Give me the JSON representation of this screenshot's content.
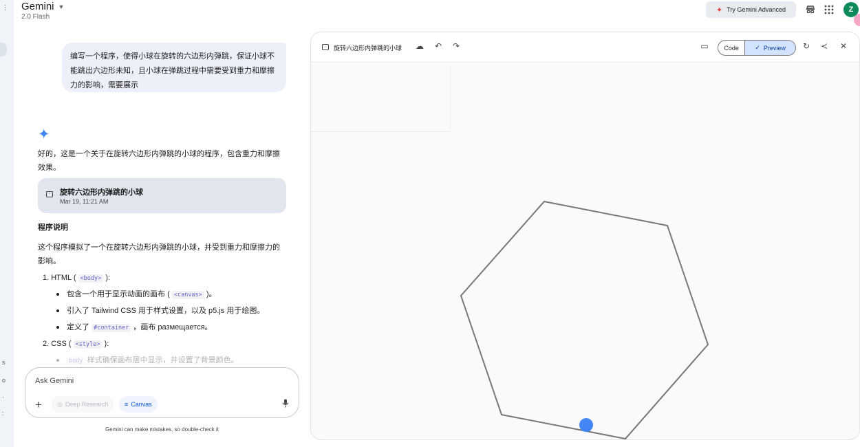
{
  "app": {
    "brand": "Gemini",
    "model": "2.0 Flash",
    "try_advanced": "Try Gemini Advanced",
    "avatar_letter": "Z"
  },
  "chat": {
    "user_prompt": "编写一个程序，使得小球在旋转的六边形内弹跳，保证小球不能跳出六边形未知，且小球在弹跳过程中需要受到重力和摩擦力的影响，需要展示",
    "reply_intro": "好的，这是一个关于在旋转六边形内弹跳的小球的程序，包含重力和摩擦效果。",
    "canvas_card": {
      "title": "旋转六边形内弹跳的小球",
      "date": "Mar 19, 11:21 AM"
    },
    "section_title": "程序说明",
    "section_para": "这个程序模拟了一个在旋转六边形内弹跳的小球，并受到重力和摩擦力的影响。",
    "list": {
      "item1_prefix": "1. HTML (",
      "item1_code": "<body>",
      "item1_suffix": "):",
      "b1_prefix": "包含一个用于显示动画的画布 (",
      "b1_code": "<canvas>",
      "b1_suffix": ")。",
      "b2": "引入了 Tailwind CSS 用于样式设置，以及 p5.js 用于绘图。",
      "b3_prefix": "定义了",
      "b3_code": "#container",
      "b3_suffix": "，画布 размещается。",
      "item2_prefix": "2. CSS (",
      "item2_code": "<style>",
      "item2_suffix": "):",
      "b4_code": "body",
      "b4_suffix": "样式确保画布居中显示，并设置了背景颜色。"
    }
  },
  "composer": {
    "placeholder": "Ask Gemini",
    "deep_research": "Deep Research",
    "canvas": "Canvas",
    "disclaimer": "Gemini can make mistakes, so double-check it"
  },
  "canvas_panel": {
    "title": "旋转六边形内弹跳的小球",
    "code_label": "Code",
    "preview_label": "Preview"
  },
  "colors": {
    "hexagon_stroke": "#77767b",
    "ball": "#4285f4",
    "accent": "#0b57d0"
  },
  "icons": [
    "menu-icon",
    "chevron-down-icon",
    "sparkle-icon",
    "incognito-icon",
    "apps-grid-icon",
    "gemini-star-icon",
    "canvas-doc-icon",
    "plus-icon",
    "deep-research-icon",
    "canvas-icon",
    "mic-icon",
    "cloud-icon",
    "undo-icon",
    "redo-icon",
    "console-icon",
    "check-icon",
    "refresh-icon",
    "share-icon",
    "close-icon"
  ]
}
